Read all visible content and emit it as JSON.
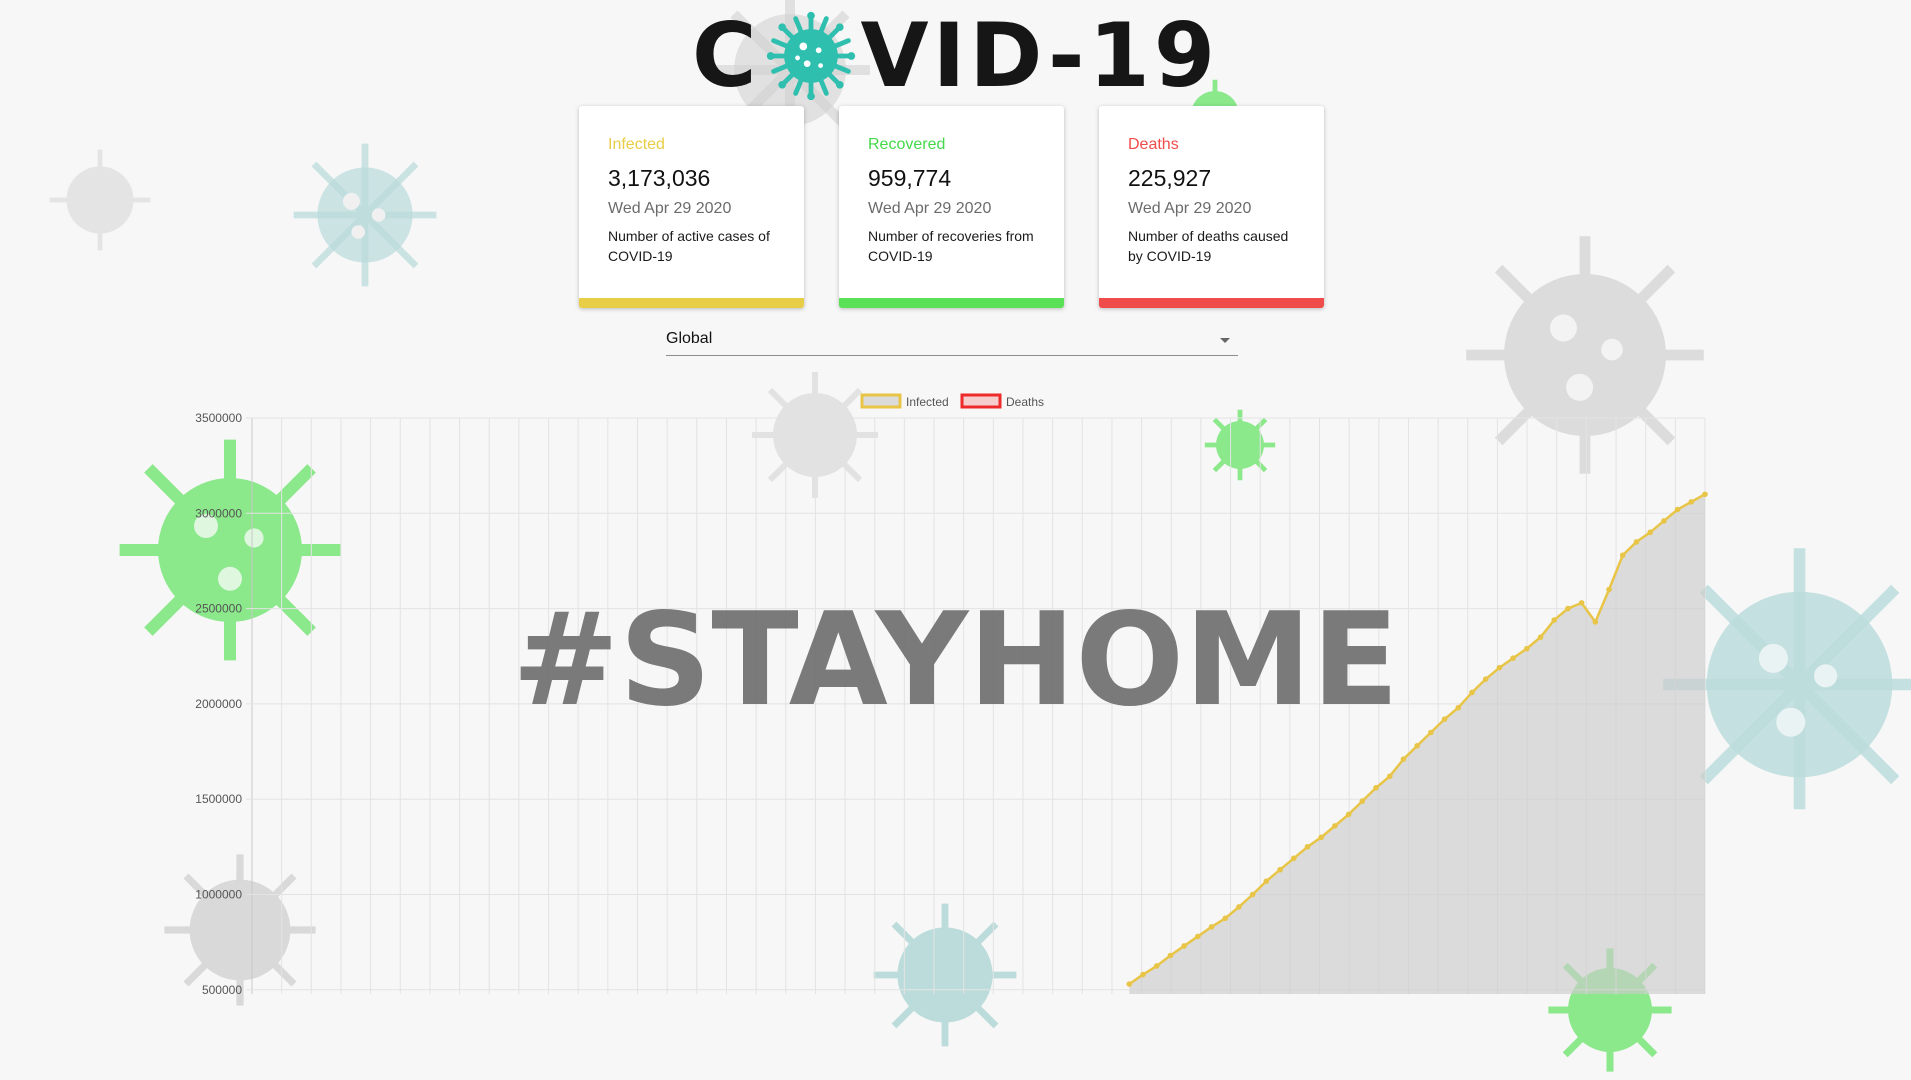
{
  "header": {
    "logo_left": "C",
    "logo_right": "VID-19",
    "logo_o_icon": "virus-icon"
  },
  "cards": [
    {
      "label": "Infected",
      "value": "3,173,036",
      "date": "Wed Apr 29 2020",
      "description": "Number of active cases of COVID-19",
      "color": "#e8cd47"
    },
    {
      "label": "Recovered",
      "value": "959,774",
      "date": "Wed Apr 29 2020",
      "description": "Number of recoveries from COVID-19",
      "color": "#5be158"
    },
    {
      "label": "Deaths",
      "value": "225,927",
      "date": "Wed Apr 29 2020",
      "description": "Number of deaths caused by COVID-19",
      "color": "#f14c4c"
    }
  ],
  "country_select": {
    "value": "Global"
  },
  "overlay_text": "#STAYHOME",
  "chart_data": {
    "type": "line",
    "title": "",
    "xlabel": "",
    "ylabel": "",
    "ylim": [
      500000,
      3500000
    ],
    "y_ticks": [
      "3500000",
      "3000000",
      "2500000",
      "2000000",
      "1500000",
      "1000000",
      "500000"
    ],
    "grid": true,
    "legend_position": "top",
    "series": [
      {
        "name": "Infected",
        "color": "#e8c547",
        "points": [
          [
            64,
            530000
          ],
          [
            65,
            580000
          ],
          [
            66,
            625000
          ],
          [
            67,
            680000
          ],
          [
            68,
            730000
          ],
          [
            69,
            780000
          ],
          [
            70,
            830000
          ],
          [
            71,
            875000
          ],
          [
            72,
            935000
          ],
          [
            73,
            1000000
          ],
          [
            74,
            1070000
          ],
          [
            75,
            1130000
          ],
          [
            76,
            1190000
          ],
          [
            77,
            1250000
          ],
          [
            78,
            1300000
          ],
          [
            79,
            1360000
          ],
          [
            80,
            1420000
          ],
          [
            81,
            1490000
          ],
          [
            82,
            1560000
          ],
          [
            83,
            1620000
          ],
          [
            84,
            1710000
          ],
          [
            85,
            1780000
          ],
          [
            86,
            1850000
          ],
          [
            87,
            1920000
          ],
          [
            88,
            1980000
          ],
          [
            89,
            2060000
          ],
          [
            90,
            2130000
          ],
          [
            91,
            2190000
          ],
          [
            92,
            2240000
          ],
          [
            93,
            2290000
          ],
          [
            94,
            2350000
          ],
          [
            95,
            2440000
          ],
          [
            96,
            2500000
          ],
          [
            97,
            2530000
          ],
          [
            98,
            2430000
          ],
          [
            99,
            2600000
          ],
          [
            100,
            2780000
          ],
          [
            101,
            2850000
          ],
          [
            102,
            2900000
          ],
          [
            103,
            2960000
          ],
          [
            104,
            3020000
          ],
          [
            105,
            3060000
          ],
          [
            106,
            3100000
          ]
        ]
      },
      {
        "name": "Deaths",
        "color": "#ee2a2a",
        "points": []
      }
    ]
  }
}
